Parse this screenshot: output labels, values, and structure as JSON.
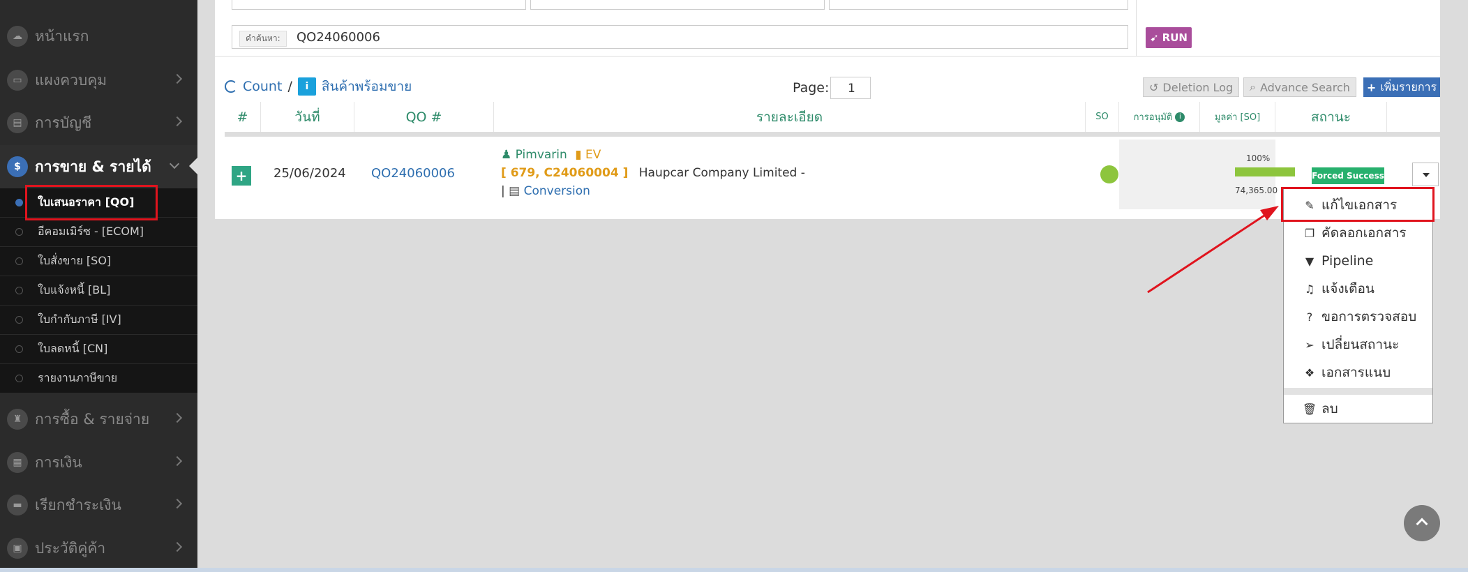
{
  "sidebar": {
    "items": [
      {
        "label": "หน้าแรก",
        "icon": "cloud-icon"
      },
      {
        "label": "แผงควบคุม",
        "icon": "monitor-icon"
      },
      {
        "label": "การบัญชี",
        "icon": "book-icon"
      },
      {
        "label": "การขาย & รายได้",
        "icon": "dollar-icon"
      },
      {
        "label": "การซื้อ & รายจ่าย",
        "icon": "cart-icon"
      },
      {
        "label": "การเงิน",
        "icon": "calendar-icon"
      },
      {
        "label": "เรียกชำระเงิน",
        "icon": "card-icon"
      },
      {
        "label": "ประวัติคู่ค้า",
        "icon": "contact-book-icon"
      }
    ],
    "subitems": [
      "ใบเสนอราคา [QO]",
      "อีคอมเมิร์ซ - [ECOM]",
      "ใบสั่งขาย [SO]",
      "ใบแจ้งหนี้ [BL]",
      "ใบกำกับภาษี [IV]",
      "ใบลดหนี้ [CN]",
      "รายงานภาษีขาย"
    ]
  },
  "search": {
    "label": "คำค้นหา:",
    "value": "QO24060006",
    "run": "RUN"
  },
  "toolbar": {
    "count": "Count",
    "slash": "/",
    "stock": "สินค้าพร้อมขาย",
    "page_label": "Page:",
    "page": "1",
    "deletion_log": "Deletion Log",
    "advance_search": "Advance Search",
    "add": "เพิ่มรายการ"
  },
  "table": {
    "headers": [
      "#",
      "วันที่",
      "QO #",
      "รายละเอียด",
      "SO",
      "การอนุมัติ",
      "มูลค่า [SO]",
      "สถานะ"
    ],
    "row": {
      "date": "25/06/2024",
      "qo": "QO24060006",
      "user": "Pimvarin",
      "tag": "EV",
      "ref": "[ 679, C24060004 ]",
      "company": "Haupcar Company Limited -",
      "pipe": "|",
      "conversion": "Conversion",
      "progress_label": "100%",
      "progress": 1.0,
      "amount": "74,365.00",
      "status": "Forced Success"
    }
  },
  "menu": {
    "items": [
      {
        "label": "แก้ไขเอกสาร",
        "icon": "edit-icon",
        "glyph": "✎"
      },
      {
        "label": "คัดลอกเอกสาร",
        "icon": "copy-icon",
        "glyph": "❐"
      },
      {
        "label": "Pipeline",
        "icon": "filter-icon",
        "glyph": "▼"
      },
      {
        "label": "แจ้งเตือน",
        "icon": "bell-icon",
        "glyph": "♫"
      },
      {
        "label": "ขอการตรวจสอบ",
        "icon": "question-icon",
        "glyph": "?"
      },
      {
        "label": "เปลี่ยนสถานะ",
        "icon": "send-icon",
        "glyph": "➢"
      },
      {
        "label": "เอกสารแนบ",
        "icon": "dropbox-icon",
        "glyph": "❖"
      },
      {
        "label": "ลบ",
        "icon": "trash-icon",
        "glyph": "🗑"
      }
    ]
  },
  "colors": {
    "accent": "#3b6fb6",
    "success": "#27b06d",
    "highlight": "#e0141e",
    "run": "#a94d9b"
  }
}
